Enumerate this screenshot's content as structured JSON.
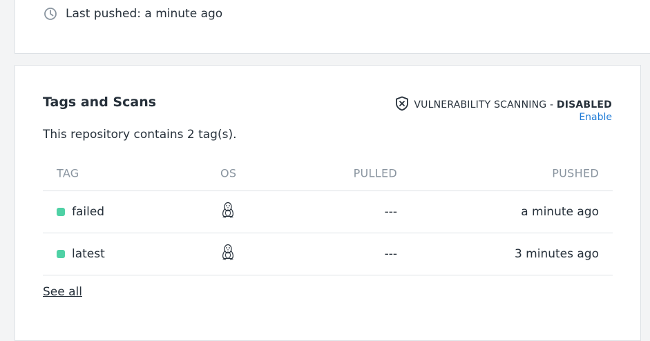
{
  "repo_info": {
    "last_pushed": "Last pushed: a minute ago"
  },
  "tags_section": {
    "title": "Tags and Scans",
    "vulnerability_label": "VULNERABILITY SCANNING - ",
    "vulnerability_status": "DISABLED",
    "enable_label": "Enable",
    "description": "This repository contains 2 tag(s).",
    "columns": {
      "tag": "TAG",
      "os": "OS",
      "pulled": "PULLED",
      "pushed": "PUSHED"
    },
    "rows": [
      {
        "tag": "failed",
        "os_icon": "linux-icon",
        "pulled": "---",
        "pushed": "a minute ago",
        "status_color": "#4fd1a5"
      },
      {
        "tag": "latest",
        "os_icon": "linux-icon",
        "pulled": "---",
        "pushed": "3 minutes ago",
        "status_color": "#4fd1a5"
      }
    ],
    "see_all_label": "See all"
  },
  "colors": {
    "accent_link": "#1d7ad6",
    "status_ok": "#4fd1a5"
  }
}
